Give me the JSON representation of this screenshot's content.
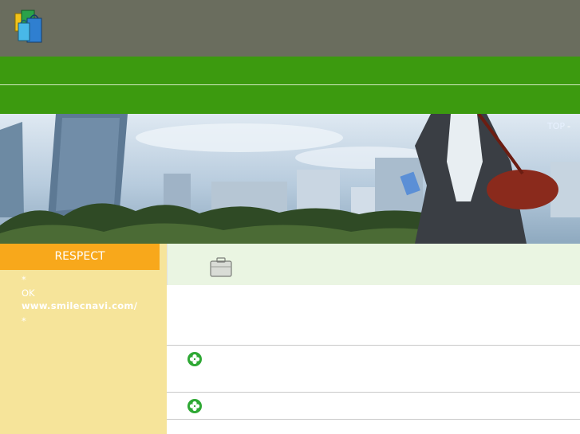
{
  "header": {
    "title": "",
    "logo_icon": "shopping-bags-logo"
  },
  "nav": {
    "row1": [
      "",
      "",
      "",
      "",
      ""
    ],
    "row2": [
      "",
      "",
      "",
      "",
      ""
    ]
  },
  "breadcrumb": {
    "top": "TOP",
    "separator": "-",
    "current": ""
  },
  "sidebar": {
    "heading": "RESPECT",
    "bullet": "*",
    "item1_title": "",
    "item1_body": "OK",
    "item1_url": "www.smilecnavi.com/",
    "item2_title": "",
    "item2_body": ""
  },
  "main": {
    "title": "",
    "title_icon": "briefcase-icon",
    "intro": "",
    "section1_title": "",
    "section1_text": "",
    "section2_title": "",
    "section2_text": "",
    "section_icon": "clover-icon"
  },
  "colors": {
    "header_bg": "#6a6d5e",
    "nav_bg": "#3c9a0f",
    "sidebar_bg": "#f6e49a",
    "sidebar_head": "#f8a81b",
    "main_head_bg": "#eaf5e2",
    "link": "#10108a"
  }
}
